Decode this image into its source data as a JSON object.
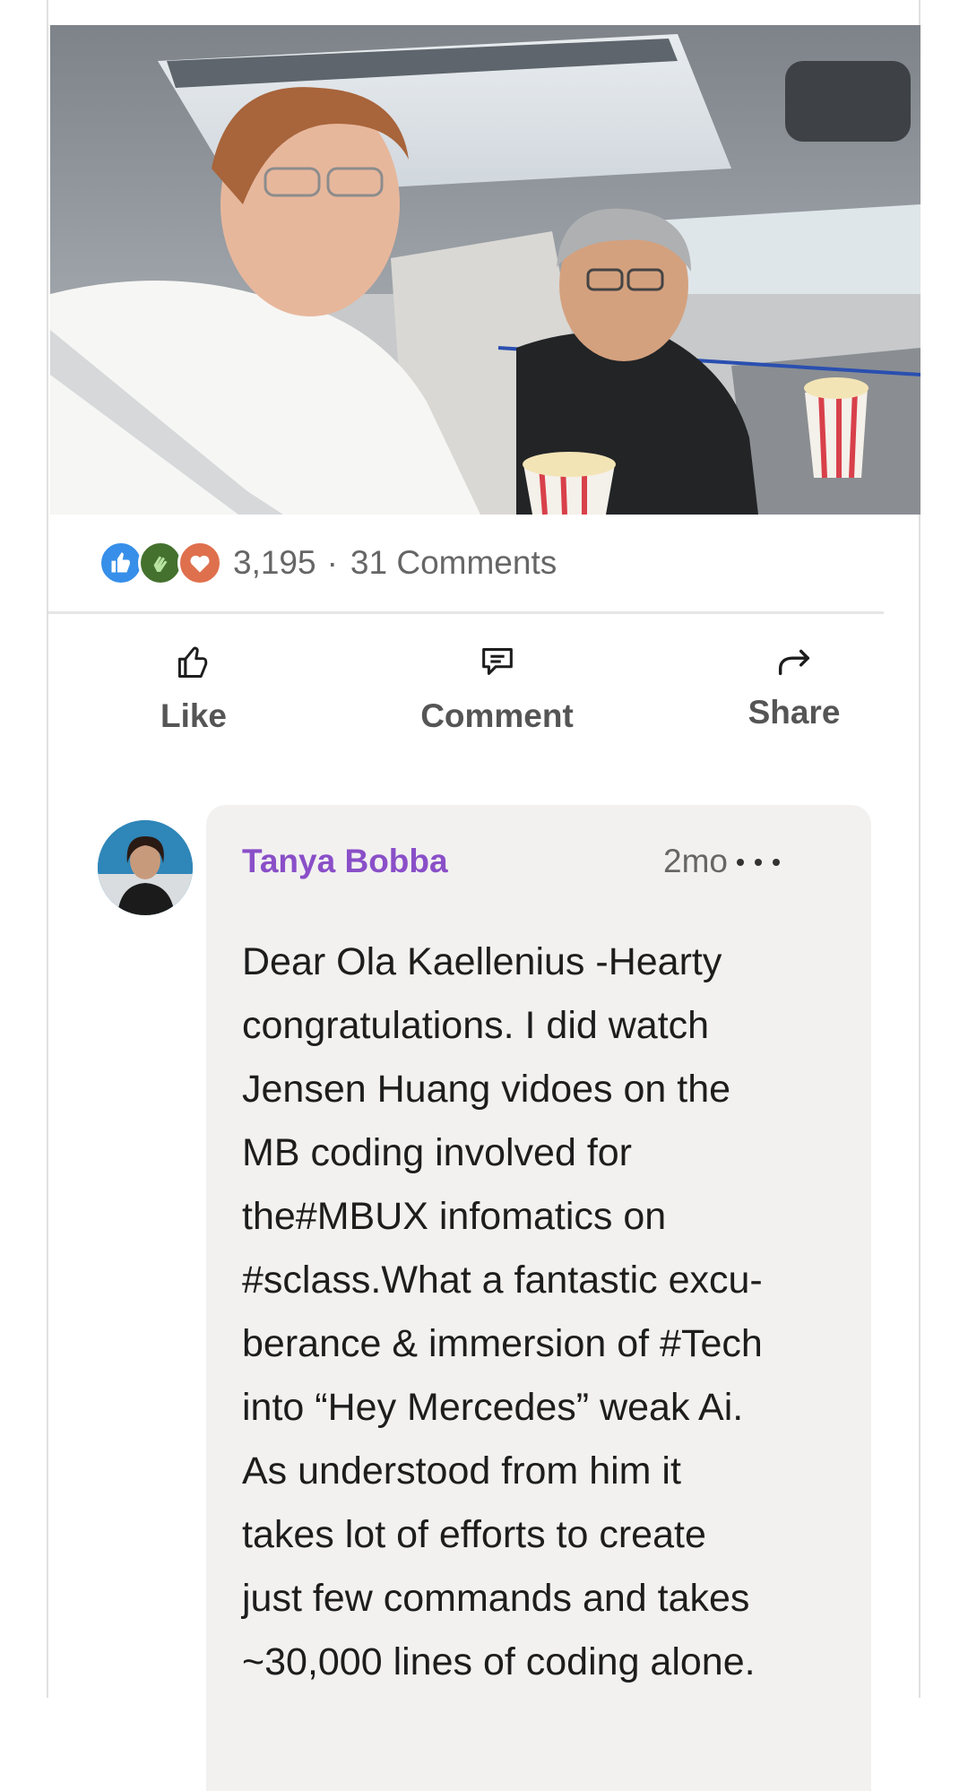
{
  "post": {
    "media_image": "photo-two-men-in-car-with-popcorn",
    "reaction_icons": [
      "like-icon",
      "celebrate-icon",
      "love-icon"
    ],
    "reaction_count": "3,195",
    "separator": "·",
    "comments_count": "31 Comments"
  },
  "actions": {
    "like_label": "Like",
    "comment_label": "Comment",
    "share_label": "Share"
  },
  "comment": {
    "author": "Tanya Bobba",
    "time": "2mo",
    "lines": [
      "Dear Ola Kaellenius -Hearty",
      "congratulations. I did watch",
      "Jensen Huang vidoes on the",
      "MB coding involved for",
      "the#MBUX infomatics on",
      "#sclass.What a fantastic excu-",
      "berance & immersion of #Tech",
      "into “Hey Mercedes” weak Ai.",
      "As understood from him it",
      "takes lot of efforts to create",
      "just few commands and takes",
      "~30,000 lines of coding alone."
    ]
  },
  "colors": {
    "author_name": "#8a4fc8",
    "like_blue": "#378fe9",
    "celebrate_green": "#44712e",
    "love_orange": "#df704d",
    "bubble_bg": "#f2f1f0"
  }
}
